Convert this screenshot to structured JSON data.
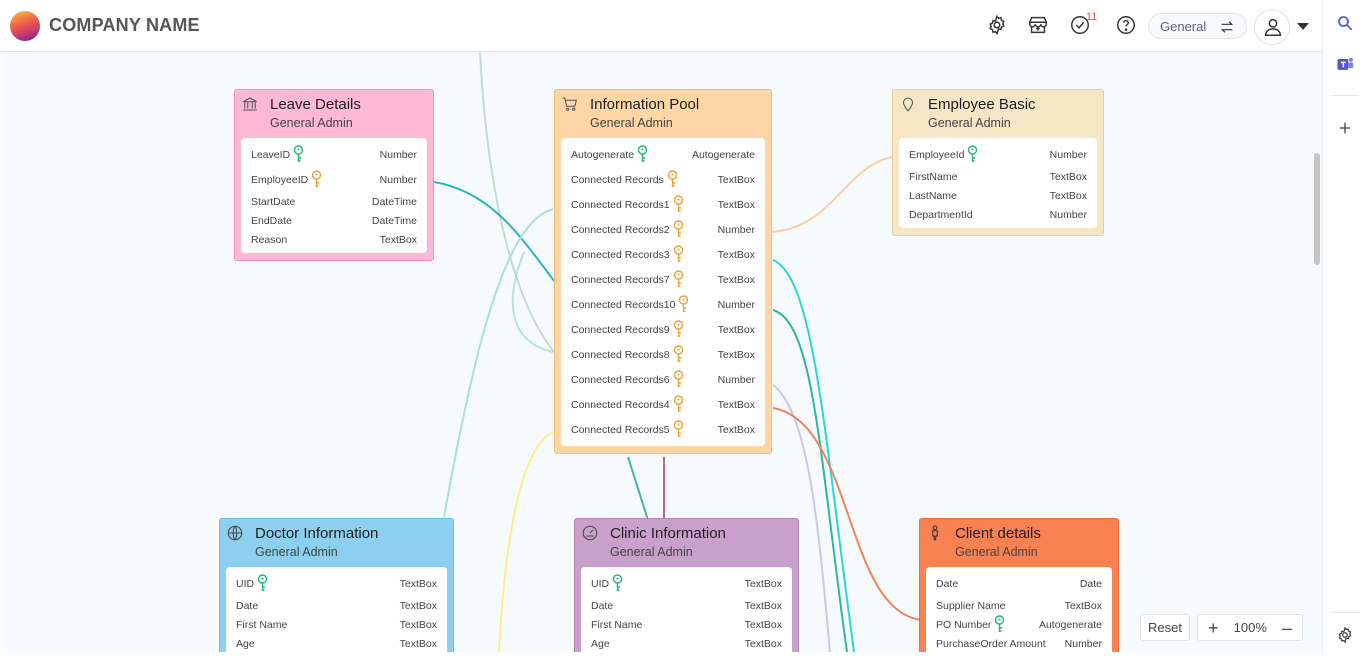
{
  "header": {
    "company_name": "COMPANY NAME",
    "notification_count": "11",
    "workspace": "General",
    "icons": [
      "settings-icon",
      "store-icon",
      "tasks-check-icon",
      "help-icon",
      "swap-icon",
      "user-icon",
      "chevron-down-icon"
    ]
  },
  "rail": {
    "icons": [
      "search-icon",
      "teams-icon",
      "add-icon",
      "settings-icon"
    ]
  },
  "zoom": {
    "reset_label": "Reset",
    "level": "100%"
  },
  "colors": {
    "leave": "#fdb8d6",
    "info": "#fdd6a6",
    "employee": "#f5e6c6",
    "doctor": "#8ccfee",
    "clinic": "#c9a0cb",
    "client": "#f98152",
    "primary_key": "#22b573",
    "foreign_key": "#e8a038"
  },
  "tables": {
    "leave": {
      "title": "Leave Details",
      "subtitle": "General Admin",
      "icon": "bank-icon",
      "fields": [
        {
          "name": "LeaveID",
          "type": "Number",
          "key": "primary"
        },
        {
          "name": "EmployeeID",
          "type": "Number",
          "key": "foreign"
        },
        {
          "name": "StartDate",
          "type": "DateTime",
          "key": ""
        },
        {
          "name": "EndDate",
          "type": "DateTime",
          "key": ""
        },
        {
          "name": "Reason",
          "type": "TextBox",
          "key": ""
        }
      ]
    },
    "info": {
      "title": "Information Pool",
      "subtitle": "General Admin",
      "icon": "cart-icon",
      "fields": [
        {
          "name": "Autogenerate",
          "type": "Autogenerate",
          "key": "primary"
        },
        {
          "name": "Connected Records",
          "type": "TextBox",
          "key": "foreign"
        },
        {
          "name": "Connected Records1",
          "type": "TextBox",
          "key": "foreign"
        },
        {
          "name": "Connected Records2",
          "type": "Number",
          "key": "foreign"
        },
        {
          "name": "Connected Records3",
          "type": "TextBox",
          "key": "foreign"
        },
        {
          "name": "Connected Records7",
          "type": "TextBox",
          "key": "foreign"
        },
        {
          "name": "Connected Records10",
          "type": "Number",
          "key": "foreign"
        },
        {
          "name": "Connected Records9",
          "type": "TextBox",
          "key": "foreign"
        },
        {
          "name": "Connected Records8",
          "type": "TextBox",
          "key": "foreign"
        },
        {
          "name": "Connected Records6",
          "type": "Number",
          "key": "foreign"
        },
        {
          "name": "Connected Records4",
          "type": "TextBox",
          "key": "foreign"
        },
        {
          "name": "Connected Records5",
          "type": "TextBox",
          "key": "foreign"
        }
      ]
    },
    "employee": {
      "title": "Employee Basic",
      "subtitle": "General Admin",
      "icon": "map-pin-icon",
      "fields": [
        {
          "name": "EmployeeId",
          "type": "Number",
          "key": "primary"
        },
        {
          "name": "FirstName",
          "type": "TextBox",
          "key": ""
        },
        {
          "name": "LastName",
          "type": "TextBox",
          "key": ""
        },
        {
          "name": "DepartmentId",
          "type": "Number",
          "key": ""
        }
      ]
    },
    "doctor": {
      "title": "Doctor Information",
      "subtitle": "General Admin",
      "icon": "globe-icon",
      "fields": [
        {
          "name": "UID",
          "type": "TextBox",
          "key": "primary"
        },
        {
          "name": "Date",
          "type": "TextBox",
          "key": ""
        },
        {
          "name": "First Name",
          "type": "TextBox",
          "key": ""
        },
        {
          "name": "Age",
          "type": "TextBox",
          "key": ""
        }
      ]
    },
    "clinic": {
      "title": "Clinic Information",
      "subtitle": "General Admin",
      "icon": "dashboard-icon",
      "fields": [
        {
          "name": "UID",
          "type": "TextBox",
          "key": "primary"
        },
        {
          "name": "Date",
          "type": "TextBox",
          "key": ""
        },
        {
          "name": "First Name",
          "type": "TextBox",
          "key": ""
        },
        {
          "name": "Age",
          "type": "TextBox",
          "key": ""
        }
      ]
    },
    "client": {
      "title": "Client details",
      "subtitle": "General Admin",
      "icon": "person-icon",
      "fields": [
        {
          "name": "Date",
          "type": "Date",
          "key": ""
        },
        {
          "name": "Supplier Name",
          "type": "TextBox",
          "key": ""
        },
        {
          "name": "PO Number",
          "type": "Autogenerate",
          "key": "primary"
        },
        {
          "name": "PurchaseOrder Amount",
          "type": "Number",
          "key": ""
        }
      ]
    }
  }
}
